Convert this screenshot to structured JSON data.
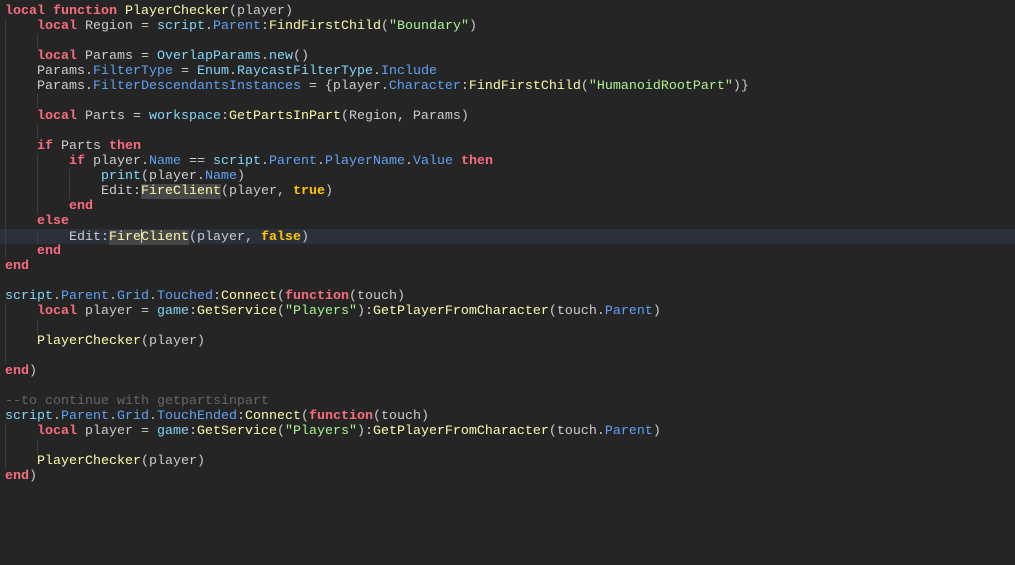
{
  "colors": {
    "background": "#252525",
    "keyword": "#f86d7c",
    "builtin": "#84d6f7",
    "property": "#61a1f1",
    "method": "#fdfbac",
    "string": "#adf195",
    "boolean": "#ffc600",
    "comment": "#666666",
    "text": "#cccccc"
  },
  "editor": {
    "current_line": 15,
    "lines": [
      {
        "tokens": [
          [
            "kw",
            "local"
          ],
          [
            "txt",
            " "
          ],
          [
            "kw",
            "function"
          ],
          [
            "txt",
            " "
          ],
          [
            "fn",
            "PlayerChecker"
          ],
          [
            "txt",
            "(player)"
          ]
        ]
      },
      {
        "tokens": [
          [
            "txt",
            "    "
          ],
          [
            "kw",
            "local"
          ],
          [
            "txt",
            " Region = "
          ],
          [
            "bi",
            "script"
          ],
          [
            "txt",
            "."
          ],
          [
            "prop",
            "Parent"
          ],
          [
            "txt",
            ":"
          ],
          [
            "fn",
            "FindFirstChild"
          ],
          [
            "txt",
            "("
          ],
          [
            "str",
            "\"Boundary\""
          ],
          [
            "txt",
            ")"
          ]
        ]
      },
      {
        "tokens": []
      },
      {
        "tokens": [
          [
            "txt",
            "    "
          ],
          [
            "kw",
            "local"
          ],
          [
            "txt",
            " Params = "
          ],
          [
            "bi",
            "OverlapParams"
          ],
          [
            "txt",
            "."
          ],
          [
            "bi",
            "new"
          ],
          [
            "txt",
            "()"
          ]
        ]
      },
      {
        "tokens": [
          [
            "txt",
            "    Params."
          ],
          [
            "prop",
            "FilterType"
          ],
          [
            "txt",
            " = "
          ],
          [
            "bi",
            "Enum"
          ],
          [
            "txt",
            "."
          ],
          [
            "bi",
            "RaycastFilterType"
          ],
          [
            "txt",
            "."
          ],
          [
            "prop",
            "Include"
          ]
        ]
      },
      {
        "tokens": [
          [
            "txt",
            "    Params."
          ],
          [
            "prop",
            "FilterDescendantsInstances"
          ],
          [
            "txt",
            " = {player."
          ],
          [
            "prop",
            "Character"
          ],
          [
            "txt",
            ":"
          ],
          [
            "fn",
            "FindFirstChild"
          ],
          [
            "txt",
            "("
          ],
          [
            "str",
            "\"HumanoidRootPart\""
          ],
          [
            "txt",
            ")}"
          ]
        ]
      },
      {
        "tokens": []
      },
      {
        "tokens": [
          [
            "txt",
            "    "
          ],
          [
            "kw",
            "local"
          ],
          [
            "txt",
            " Parts = "
          ],
          [
            "bi",
            "workspace"
          ],
          [
            "txt",
            ":"
          ],
          [
            "fn",
            "GetPartsInPart"
          ],
          [
            "txt",
            "(Region, Params)"
          ]
        ]
      },
      {
        "tokens": []
      },
      {
        "tokens": [
          [
            "txt",
            "    "
          ],
          [
            "kw",
            "if"
          ],
          [
            "txt",
            " Parts "
          ],
          [
            "kw",
            "then"
          ]
        ]
      },
      {
        "tokens": [
          [
            "txt",
            "        "
          ],
          [
            "kw",
            "if"
          ],
          [
            "txt",
            " player."
          ],
          [
            "prop",
            "Name"
          ],
          [
            "txt",
            " == "
          ],
          [
            "bi",
            "script"
          ],
          [
            "txt",
            "."
          ],
          [
            "prop",
            "Parent"
          ],
          [
            "txt",
            "."
          ],
          [
            "prop",
            "PlayerName"
          ],
          [
            "txt",
            "."
          ],
          [
            "prop",
            "Value"
          ],
          [
            "txt",
            " "
          ],
          [
            "kw",
            "then"
          ]
        ]
      },
      {
        "tokens": [
          [
            "txt",
            "            "
          ],
          [
            "bi",
            "print"
          ],
          [
            "txt",
            "(player."
          ],
          [
            "prop",
            "Name"
          ],
          [
            "txt",
            ")"
          ]
        ]
      },
      {
        "tokens": [
          [
            "txt",
            "            Edit:"
          ],
          [
            "fn hl",
            "FireClient"
          ],
          [
            "txt",
            "(player, "
          ],
          [
            "bool",
            "true"
          ],
          [
            "txt",
            ")"
          ]
        ]
      },
      {
        "tokens": [
          [
            "txt",
            "        "
          ],
          [
            "kw",
            "end"
          ]
        ]
      },
      {
        "tokens": [
          [
            "txt",
            "    "
          ],
          [
            "kw",
            "else"
          ]
        ]
      },
      {
        "tokens": [
          [
            "txt",
            "        Edit:"
          ],
          [
            "fn hl caretafter4",
            "FireClient"
          ],
          [
            "txt",
            "(player, "
          ],
          [
            "bool",
            "false"
          ],
          [
            "txt",
            ")"
          ]
        ]
      },
      {
        "tokens": [
          [
            "txt",
            "    "
          ],
          [
            "kw",
            "end"
          ]
        ]
      },
      {
        "tokens": [
          [
            "kw",
            "end"
          ]
        ]
      },
      {
        "tokens": []
      },
      {
        "tokens": [
          [
            "bi",
            "script"
          ],
          [
            "txt",
            "."
          ],
          [
            "prop",
            "Parent"
          ],
          [
            "txt",
            "."
          ],
          [
            "prop",
            "Grid"
          ],
          [
            "txt",
            "."
          ],
          [
            "prop",
            "Touched"
          ],
          [
            "txt",
            ":"
          ],
          [
            "fn",
            "Connect"
          ],
          [
            "txt",
            "("
          ],
          [
            "kw",
            "function"
          ],
          [
            "txt",
            "(touch)"
          ]
        ]
      },
      {
        "tokens": [
          [
            "txt",
            "    "
          ],
          [
            "kw",
            "local"
          ],
          [
            "txt",
            " player = "
          ],
          [
            "bi",
            "game"
          ],
          [
            "txt",
            ":"
          ],
          [
            "fn",
            "GetService"
          ],
          [
            "txt",
            "("
          ],
          [
            "str",
            "\"Players\""
          ],
          [
            "txt",
            "):"
          ],
          [
            "fn",
            "GetPlayerFromCharacter"
          ],
          [
            "txt",
            "(touch."
          ],
          [
            "prop",
            "Parent"
          ],
          [
            "txt",
            ")"
          ]
        ]
      },
      {
        "tokens": []
      },
      {
        "tokens": [
          [
            "txt",
            "    "
          ],
          [
            "fn",
            "PlayerChecker"
          ],
          [
            "txt",
            "(player)"
          ]
        ]
      },
      {
        "tokens": []
      },
      {
        "tokens": [
          [
            "kw",
            "end"
          ],
          [
            "txt",
            ")"
          ]
        ]
      },
      {
        "tokens": []
      },
      {
        "tokens": [
          [
            "cm",
            "--to continue with getpartsinpart"
          ]
        ]
      },
      {
        "tokens": [
          [
            "bi",
            "script"
          ],
          [
            "txt",
            "."
          ],
          [
            "prop",
            "Parent"
          ],
          [
            "txt",
            "."
          ],
          [
            "prop",
            "Grid"
          ],
          [
            "txt",
            "."
          ],
          [
            "prop",
            "TouchEnded"
          ],
          [
            "txt",
            ":"
          ],
          [
            "fn",
            "Connect"
          ],
          [
            "txt",
            "("
          ],
          [
            "kw",
            "function"
          ],
          [
            "txt",
            "(touch)"
          ]
        ]
      },
      {
        "tokens": [
          [
            "txt",
            "    "
          ],
          [
            "kw",
            "local"
          ],
          [
            "txt",
            " player = "
          ],
          [
            "bi",
            "game"
          ],
          [
            "txt",
            ":"
          ],
          [
            "fn",
            "GetService"
          ],
          [
            "txt",
            "("
          ],
          [
            "str",
            "\"Players\""
          ],
          [
            "txt",
            "):"
          ],
          [
            "fn",
            "GetPlayerFromCharacter"
          ],
          [
            "txt",
            "(touch."
          ],
          [
            "prop",
            "Parent"
          ],
          [
            "txt",
            ")"
          ]
        ]
      },
      {
        "tokens": []
      },
      {
        "tokens": [
          [
            "txt",
            "    "
          ],
          [
            "fn",
            "PlayerChecker"
          ],
          [
            "txt",
            "(player)"
          ]
        ]
      },
      {
        "tokens": [
          [
            "kw",
            "end"
          ],
          [
            "txt",
            ")"
          ]
        ]
      }
    ]
  }
}
